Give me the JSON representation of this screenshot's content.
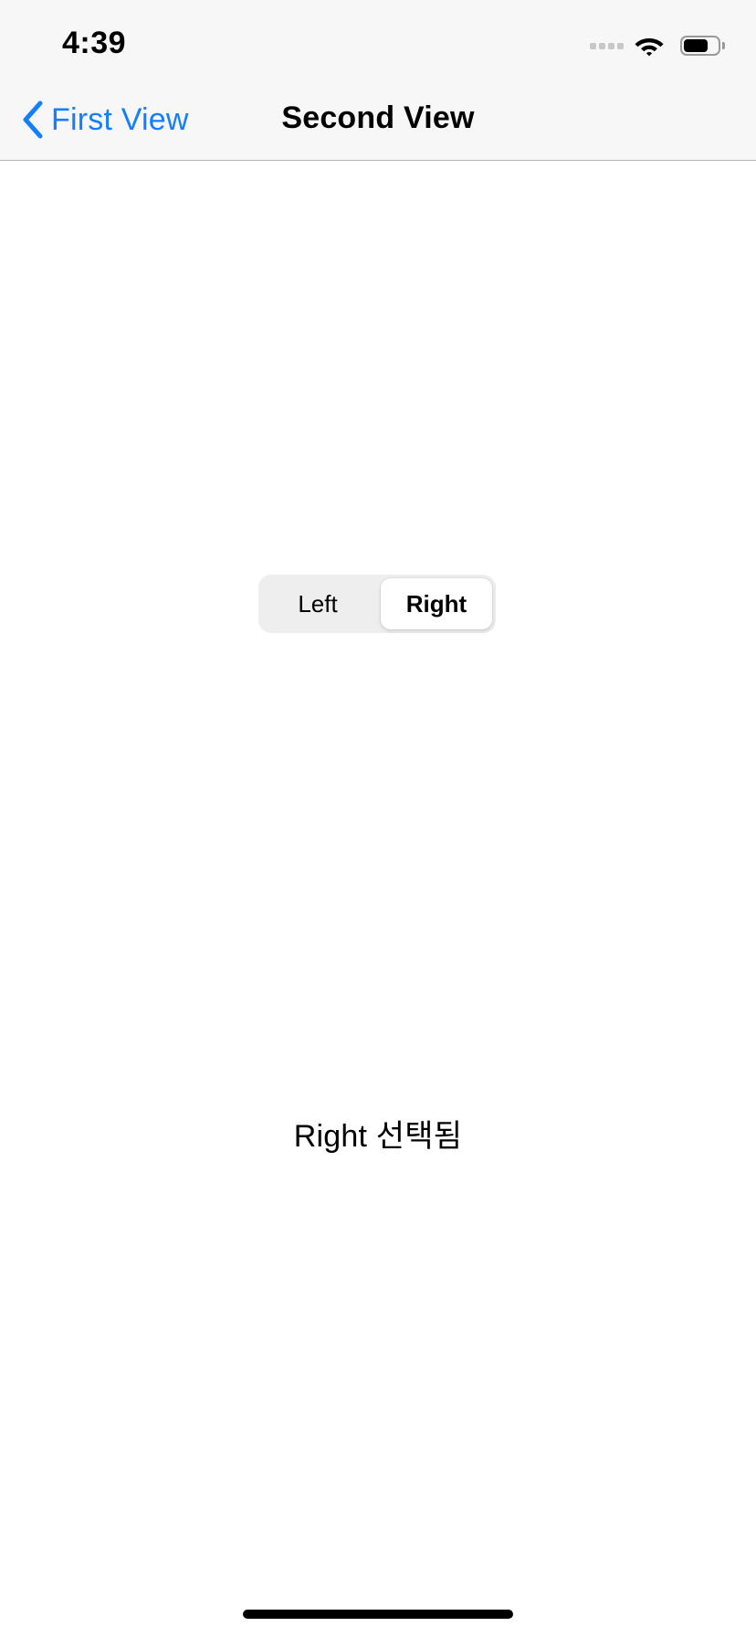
{
  "status_bar": {
    "time": "4:39",
    "battery_level": 0.72,
    "icons": [
      "signal-dots-icon",
      "wifi-icon",
      "battery-icon"
    ]
  },
  "nav_bar": {
    "back_label": "First View",
    "title": "Second View"
  },
  "segmented_control": {
    "segments": [
      "Left",
      "Right"
    ],
    "selected": "Right"
  },
  "result_text": "Right 선택됨",
  "colors": {
    "accent": "#147efb",
    "bar_background": "#f7f7f7",
    "segment_track": "#eeeeef"
  }
}
